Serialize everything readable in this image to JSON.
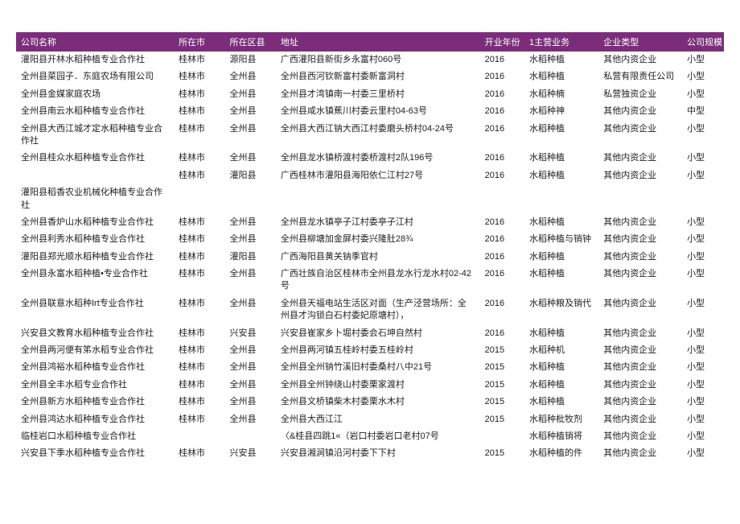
{
  "headers": {
    "name": "公司名称",
    "city": "所在市",
    "county": "所在区县",
    "address": "地址",
    "year": "开业年份",
    "business": "1主营业务",
    "type": "企业类型",
    "scale": "公司规模"
  },
  "rows": [
    {
      "name": "灌阳县开林水稻种植专业合作社",
      "city": "桂林市",
      "county": "源阳县",
      "address": "广西灌阳县新街乡永富村060号",
      "year": "2016",
      "business": "水稻种植",
      "type": "其他内资企业",
      "scale": "小型"
    },
    {
      "name": "全州县菜园子．东庭农场有限公司",
      "city": "桂林市",
      "county": "全州县",
      "address": "全州县西河钦新富村委新富洞村",
      "year": "2016",
      "business": "水稻种植",
      "type": "私营有限责任公司",
      "scale": "小型"
    },
    {
      "name": "全州县金媒家庭农场",
      "city": "桂林市",
      "county": "全州县",
      "address": "全州县才湾镇南一村委三里桥村",
      "year": "2016",
      "business": "水稻种楠",
      "type": "私营独资企业",
      "scale": "小型"
    },
    {
      "name": "全州县南云水稻种植专业合作社",
      "city": "桂林市",
      "county": "全州县",
      "address": "全州县咸水镇蕉川村委云里村04-63号",
      "year": "2016",
      "business": "水稻种神",
      "type": "其他内资企业",
      "scale": "中型"
    },
    {
      "name": "全州县大西江城才定水稻种植专业合作社",
      "city": "桂林市",
      "county": "全州县",
      "address": "全州县大西江钠大西江村委磨头桥村04-24号",
      "year": "2016",
      "business": "水稻种植",
      "type": "其他内资企业",
      "scale": "小型"
    },
    {
      "name": "全州县桂众水稻种植专业合作社",
      "city": "桂林市",
      "county": "全州县",
      "address": "全州县龙水镇桥渡村委桥渡村2队196号",
      "year": "2016",
      "business": "水稻种植",
      "type": "其他内资企业",
      "scale": "小型"
    },
    {
      "name": "",
      "city": "桂林市",
      "county": "灌阳县",
      "address": "广西桂林市灌阳县海阳依仁江村27号",
      "year": "2016",
      "business": "水稻种植",
      "type": "其他内资企业",
      "scale": "小型"
    },
    {
      "name": "灌阳县稻香农业机械化种植专业合作社",
      "city": "",
      "county": "",
      "address": "",
      "year": "",
      "business": "",
      "type": "",
      "scale": ""
    },
    {
      "name": "全州县香炉山水稻种植专业合作社",
      "city": "桂林市",
      "county": "全州县",
      "address": "全州县龙水镇亭子江村委亭子江村",
      "year": "2016",
      "business": "水稻种植",
      "type": "其他内资企业",
      "scale": "小型"
    },
    {
      "name": "全州县利秀水稻种植专业合作社",
      "city": "桂林市",
      "county": "全州县",
      "address": "全州县柳塘加金屏村委兴隆肚28¾",
      "year": "2016",
      "business": "水稻种植与销钟",
      "type": "其他内资企业",
      "scale": "小型"
    },
    {
      "name": "灌阳县郑光顺水稻种植专业合作社",
      "city": "桂林市",
      "county": "灌阳县",
      "address": "广西海阳县黄关钠季官村",
      "year": "2016",
      "business": "水稻种植",
      "type": "其他内资企业",
      "scale": "小型"
    },
    {
      "name": "全州县永富水稻种植•专业合作社",
      "city": "桂林市",
      "county": "全州县",
      "address": "广西壮族自治区桂林市全州县龙水行龙水村02-42号",
      "year": "2016",
      "business": "水稻种植",
      "type": "其他内资企业",
      "scale": "小型"
    },
    {
      "name": "全州县联意水稻种Irt专业合作社",
      "city": "桂林市",
      "county": "全州县",
      "address": "全州县天福电站生活区对面（生产泾营场所：全州县才沟锁白石村委妃原塘村），",
      "year": "2016",
      "business": "水稻种粮及销代",
      "type": "其他内资企业",
      "scale": "小型"
    },
    {
      "name": "兴安县文教育水稻种植专业合作社",
      "city": "桂林市",
      "county": "兴安县",
      "address": "兴安县崔家乡卜堀村委会石坤自然村",
      "year": "2016",
      "business": "水稻种植",
      "type": "其他内资企业",
      "scale": "小型"
    },
    {
      "name": "全州县两河便有笫水稻专业合作社",
      "city": "桂林市",
      "county": "全州县",
      "address": "全州县两河镇五桂岭村委五桂岭村",
      "year": "2015",
      "business": "水稻种机",
      "type": "其他内资企业",
      "scale": "小型"
    },
    {
      "name": "全州县鸿裕水稻种植专业合作社",
      "city": "桂林市",
      "county": "全州县",
      "address": "全州县全州钠竹溪旧村委桑村八中21号",
      "year": "2015",
      "business": "水稻种植",
      "type": "其他内资企业",
      "scale": "小型"
    },
    {
      "name": "全州县全丰水稻专业合作社",
      "city": "桂林市",
      "county": "全州县",
      "address": "全州县全州钟绕山村委栗家渡村",
      "year": "2015",
      "business": "水稻种植",
      "type": "其他内资企业",
      "scale": "小型"
    },
    {
      "name": "全州县新方水稻种植专业合作社",
      "city": "桂林市",
      "county": "全州县",
      "address": "全州县文桥镇柴木村委栗水木村",
      "year": "2015",
      "business": "水稻种植",
      "type": "其他内资企业",
      "scale": "小型"
    },
    {
      "name": "全州县鸿达水稻种植专业合作社",
      "city": "桂林市",
      "county": "全州县",
      "address": "全州县大西江江",
      "year": "2015",
      "business": "水稻种枇牧剂",
      "type": "其他内资企业",
      "scale": "小型"
    },
    {
      "name": "临桂岩口水稻种植专业合作社",
      "city": "",
      "county": "",
      "address": "〈&桂县四跳1«（岩口村委岩口老村07号",
      "year": "",
      "business": "水稻种植销将",
      "type": "其他内资企业",
      "scale": "小型"
    },
    {
      "name": "兴安县下季水稻种植专业合作社",
      "city": "桂林市",
      "county": "兴安县",
      "address": "兴安县湘涧镇沿河村委下下村",
      "year": "2015",
      "business": "水稻种植的件",
      "type": "其他内资企业",
      "scale": "小型"
    }
  ]
}
